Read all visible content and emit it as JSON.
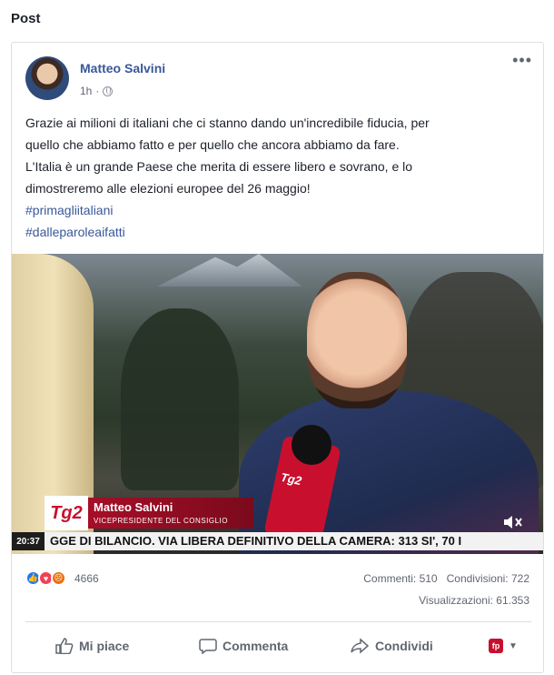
{
  "section_title": "Post",
  "post": {
    "author": "Matteo Salvini",
    "time": "1h",
    "text_lines": [
      "Grazie ai milioni di italiani che ci stanno dando un'incredibile fiducia, per",
      "quello che abbiamo fatto e per quello che ancora abbiamo da fare.",
      "L'Italia è un grande Paese che merita di essere libero e sovrano, e lo",
      "dimostreremo alle elezioni europee del 26 maggio!"
    ],
    "hashtags": [
      "#primagliitaliani",
      "#dalleparoleaifatti"
    ]
  },
  "video": {
    "caption_name": "Matteo Salvini",
    "caption_role": "VICEPRESIDENTE DEL CONSIGLIO",
    "channel_logo": "Tg2",
    "mic_label": "Tg2",
    "clock": "20:37",
    "ticker": "GGE DI BILANCIO. VIA LIBERA DEFINITIVO DELLA CAMERA: 313 SI', 70 I"
  },
  "stats": {
    "reactions_count": "4666",
    "comments": "Commenti: 510",
    "shares": "Condivisioni: 722",
    "views": "Visualizzazioni: 61.353"
  },
  "actions": {
    "like": "Mi piace",
    "comment": "Commenta",
    "share": "Condividi",
    "page_badge": "fp"
  },
  "icons": {
    "more": "more-horizontal-icon",
    "privacy": "globe-icon",
    "like": "thumbs-up-icon",
    "comment": "speech-bubble-icon",
    "share": "share-arrow-icon",
    "mute": "speaker-muted-icon"
  },
  "colors": {
    "link_blue": "#385898",
    "like_blue": "#2078f4",
    "love_red": "#f33e58",
    "angry_orange": "#e9710f",
    "tg2_red": "#c8102e"
  }
}
